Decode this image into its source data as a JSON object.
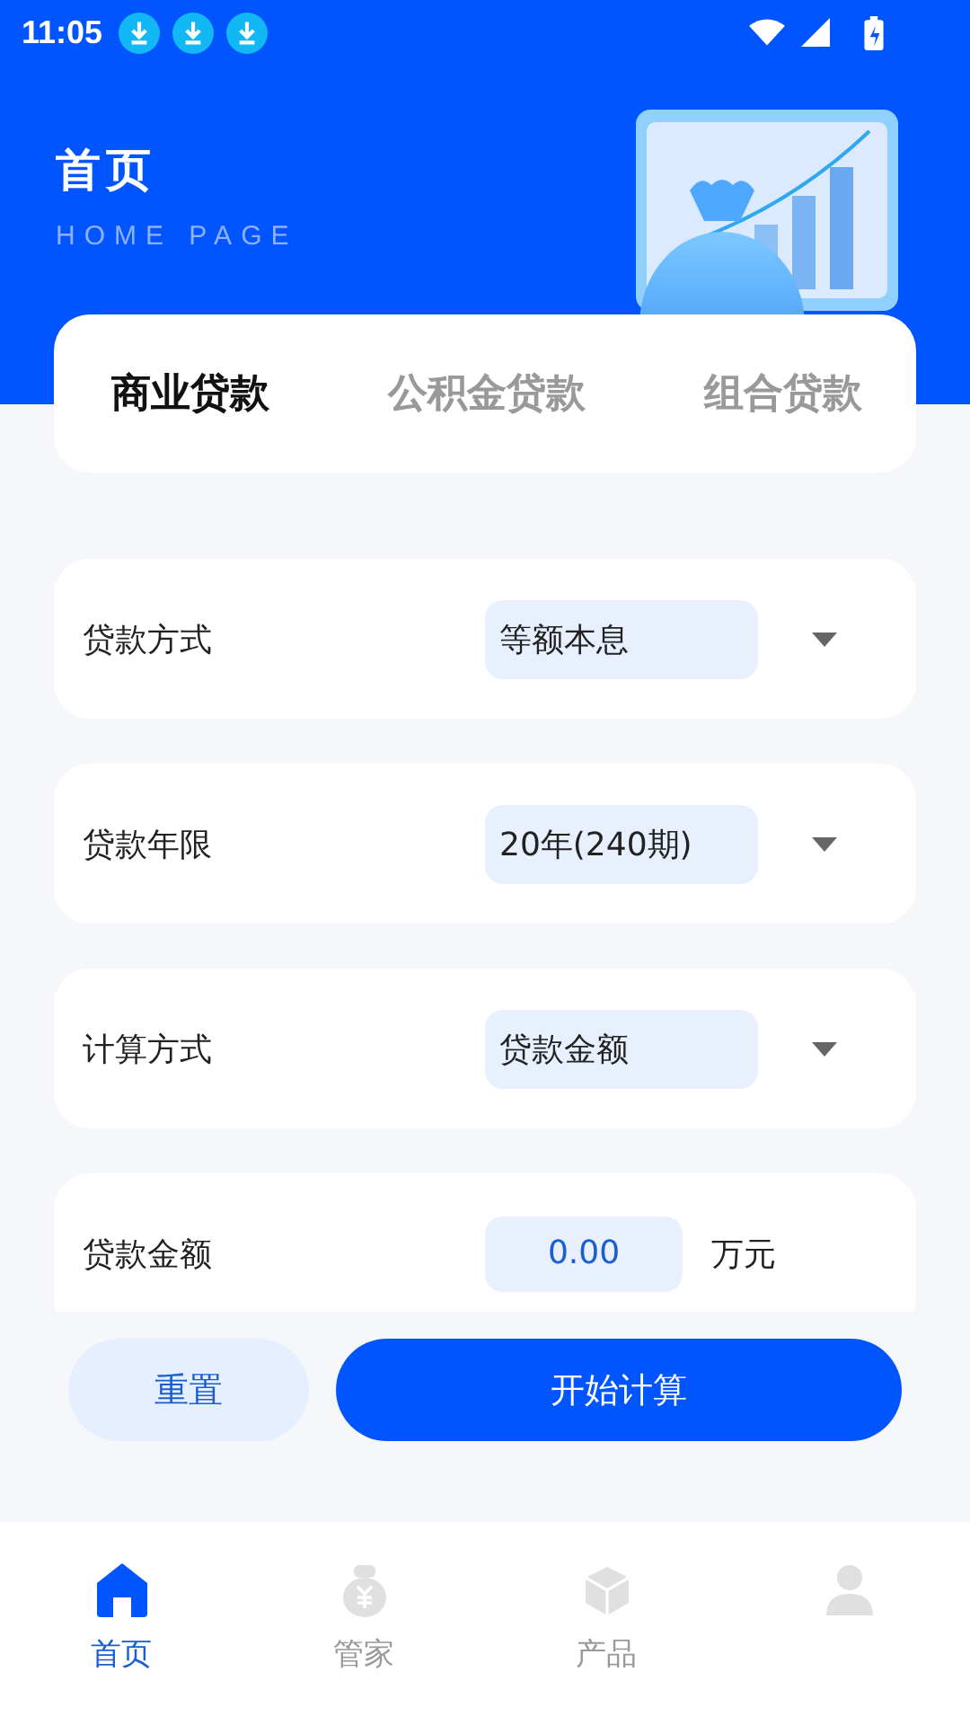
{
  "status_bar": {
    "time": "11:05",
    "notifications": [
      {
        "kind": "download"
      },
      {
        "kind": "download"
      },
      {
        "kind": "download"
      }
    ]
  },
  "header": {
    "title": "首页",
    "subtitle": "HOME PAGE"
  },
  "tabs": [
    {
      "label": "商业贷款",
      "selected": true
    },
    {
      "label": "公积金贷款",
      "selected": false
    },
    {
      "label": "组合贷款",
      "selected": false
    }
  ],
  "fields": [
    {
      "kind": "select",
      "label": "贷款方式",
      "value": "等额本息"
    },
    {
      "kind": "select",
      "label": "贷款年限",
      "value": "20年(240期)"
    },
    {
      "kind": "select",
      "label": "计算方式",
      "value": "贷款金额"
    },
    {
      "kind": "input",
      "label": "贷款金额",
      "value": "0.00",
      "unit": "万元"
    }
  ],
  "buttons": {
    "reset": "重置",
    "calculate": "开始计算"
  },
  "bottom_nav": [
    {
      "label": "首页",
      "selected": true
    },
    {
      "label": "管家",
      "selected": false
    },
    {
      "label": "产品",
      "selected": false
    },
    {
      "selected": false
    }
  ]
}
